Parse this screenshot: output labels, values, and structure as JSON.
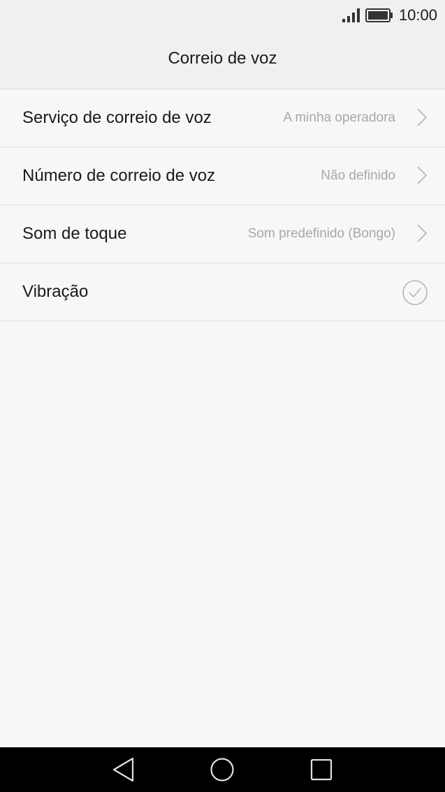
{
  "status_bar": {
    "time": "10:00",
    "icons": [
      "signal-icon",
      "battery-icon"
    ]
  },
  "header": {
    "title": "Correio de voz"
  },
  "settings": [
    {
      "label": "Serviço de correio de voz",
      "value": "A minha operadora",
      "control": "chevron-right-icon"
    },
    {
      "label": "Número de correio de voz",
      "value": "Não definido",
      "control": "chevron-right-icon"
    },
    {
      "label": "Som de toque",
      "value": "Som predefinido (Bongo)",
      "control": "chevron-right-icon"
    },
    {
      "label": "Vibração",
      "control": "checkmark-circle-icon",
      "checked": true
    }
  ],
  "nav_bar": {
    "icons": [
      "back-icon",
      "home-icon",
      "recents-icon"
    ]
  }
}
